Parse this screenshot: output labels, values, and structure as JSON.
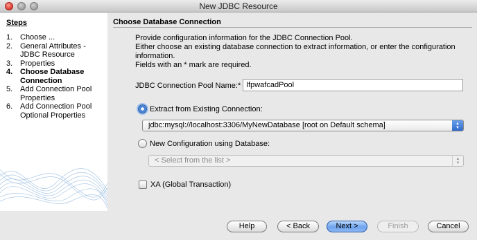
{
  "window": {
    "title": "New JDBC Resource"
  },
  "steps": {
    "heading": "Steps",
    "items": [
      {
        "num": "1.",
        "label": "Choose ...",
        "active": false
      },
      {
        "num": "2.",
        "label": "General Attributes - JDBC Resource",
        "active": false
      },
      {
        "num": "3.",
        "label": "Properties",
        "active": false
      },
      {
        "num": "4.",
        "label": "Choose Database Connection",
        "active": true
      },
      {
        "num": "5.",
        "label": "Add Connection Pool Properties",
        "active": false
      },
      {
        "num": "6.",
        "label": "Add Connection Pool Optional Properties",
        "active": false
      }
    ]
  },
  "main": {
    "heading": "Choose Database Connection",
    "info_line1": "Provide configuration information for the JDBC Connection Pool.",
    "info_line2": "Either choose an existing database connection to extract information, or enter the configuration information.",
    "info_line3": "Fields with an * mark are required.",
    "pool_name_label": "JDBC Connection Pool Name:*",
    "pool_name_value": "IfpwafcadPool",
    "extract_label": "Extract from Existing Connection:",
    "extract_selected": true,
    "connection_value": "jdbc:mysql://localhost:3306/MyNewDatabase [root on Default schema]",
    "new_config_label": "New Configuration using Database:",
    "new_config_selected": false,
    "database_placeholder": "< Select from the list >",
    "xa_label": "XA (Global Transaction)",
    "xa_checked": false
  },
  "buttons": {
    "help": "Help",
    "back": "< Back",
    "next": "Next >",
    "finish": "Finish",
    "cancel": "Cancel"
  }
}
